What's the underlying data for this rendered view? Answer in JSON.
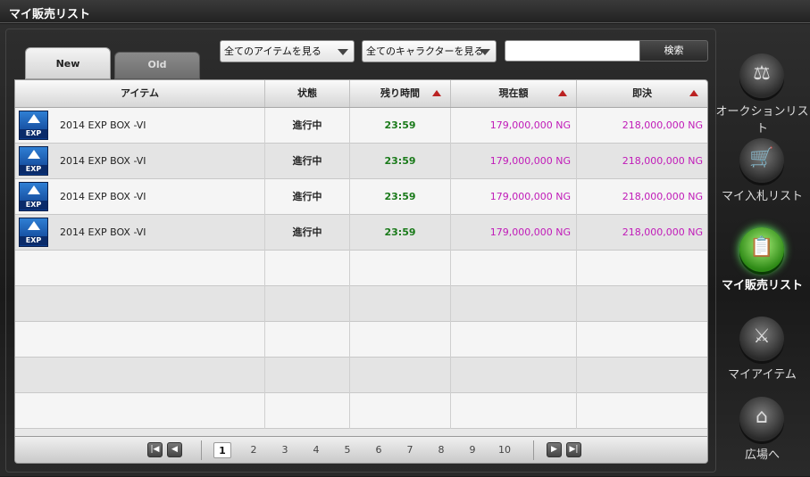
{
  "window": {
    "title": "マイ販売リスト"
  },
  "tabs": [
    {
      "label": "New",
      "active": true
    },
    {
      "label": "Old",
      "active": false
    }
  ],
  "filters": {
    "item_select": "全てのアイテムを見る",
    "character_select": "全てのキャラクターを見る",
    "search_value": "",
    "search_button": "検索"
  },
  "table": {
    "headers": {
      "item": "アイテム",
      "status": "状態",
      "time": "残り時間",
      "price": "現在額",
      "buyout": "即決"
    },
    "rows": [
      {
        "icon": "exp-box-icon",
        "icon_label": "EXP",
        "name": "2014 EXP BOX -VI",
        "status": "進行中",
        "time": "23:59",
        "price": "179,000,000 NG",
        "buyout": "218,000,000 NG"
      },
      {
        "icon": "exp-box-icon",
        "icon_label": "EXP",
        "name": "2014 EXP BOX -VI",
        "status": "進行中",
        "time": "23:59",
        "price": "179,000,000 NG",
        "buyout": "218,000,000 NG"
      },
      {
        "icon": "exp-box-icon",
        "icon_label": "EXP",
        "name": "2014 EXP BOX -VI",
        "status": "進行中",
        "time": "23:59",
        "price": "179,000,000 NG",
        "buyout": "218,000,000 NG"
      },
      {
        "icon": "exp-box-icon",
        "icon_label": "EXP",
        "name": "2014 EXP BOX -VI",
        "status": "進行中",
        "time": "23:59",
        "price": "179,000,000 NG",
        "buyout": "218,000,000 NG"
      }
    ]
  },
  "pagination": {
    "pages": [
      "1",
      "2",
      "3",
      "4",
      "5",
      "6",
      "7",
      "8",
      "9",
      "10"
    ],
    "current": "1"
  },
  "side_menu": [
    {
      "label": "オークションリスト",
      "icon": "auction-icon",
      "active": false
    },
    {
      "label": "マイ入札リスト",
      "icon": "cart-icon",
      "active": false
    },
    {
      "label": "マイ販売リスト",
      "icon": "clipboard-icon",
      "active": true
    },
    {
      "label": "マイアイテム",
      "icon": "items-icon",
      "active": false
    },
    {
      "label": "広場へ",
      "icon": "plaza-icon",
      "active": false
    }
  ],
  "colors": {
    "time": "#1a7a1a",
    "price": "#c01ab8",
    "sort_arrow": "#bb2222",
    "active_menu": "#2e8a16"
  }
}
